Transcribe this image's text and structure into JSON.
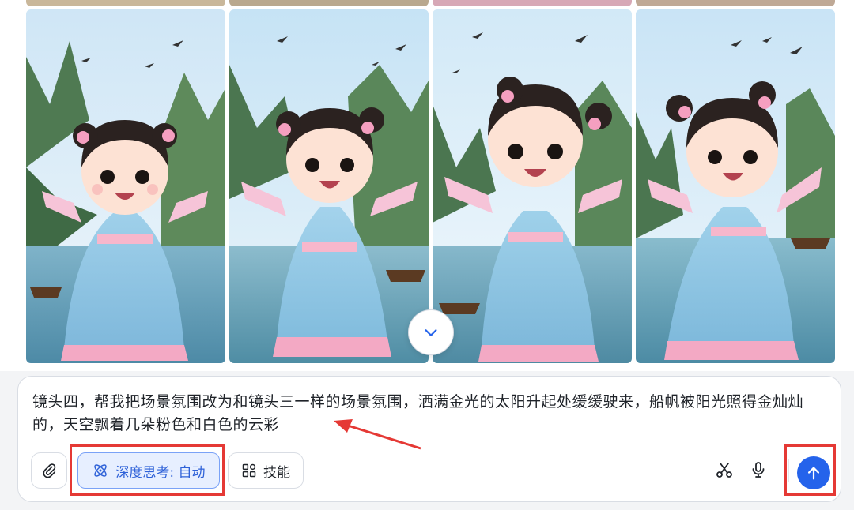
{
  "composer": {
    "prompt_text": "镜头四，帮我把场景氛围改为和镜头三一样的场景氛围，洒满金光的太阳升起处缓缓驶来，船帆被阳光照得金灿灿的，天空飘着几朵粉色和白色的云彩",
    "deep_think_label": "深度思考: 自动",
    "skills_label": "技能"
  },
  "icons": {
    "attach": "paperclip-icon",
    "deep_think": "atom-icon",
    "skills": "grid-icon",
    "scissors": "scissors-icon",
    "microphone": "microphone-icon",
    "send": "arrow-up-icon",
    "scroll_down": "chevron-down-icon"
  },
  "colors": {
    "accent": "#2563eb",
    "highlight": "#e53935",
    "deep_think_bg": "#e7efff"
  },
  "gallery": {
    "image_count": 4
  }
}
